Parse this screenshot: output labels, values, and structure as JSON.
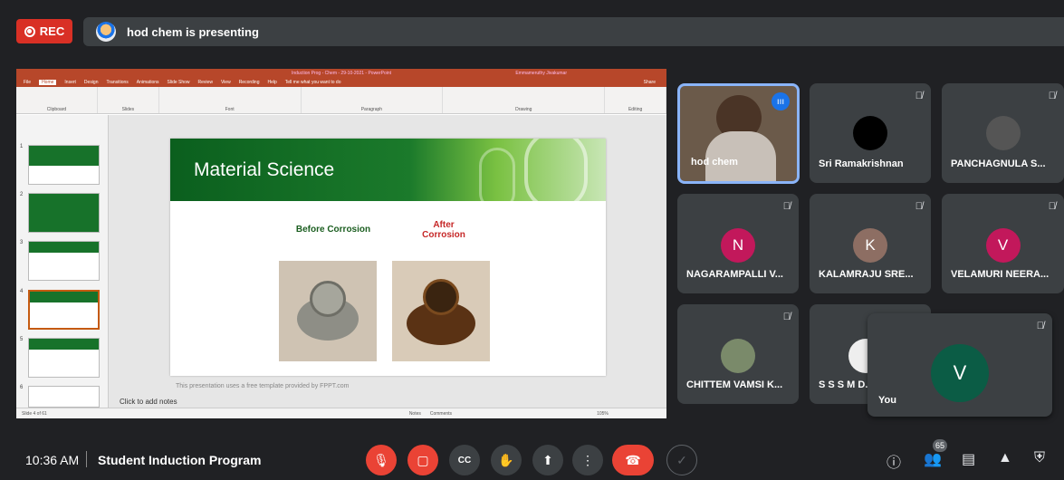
{
  "recording": {
    "label": "REC"
  },
  "presenter_bar": {
    "text": "hod chem is presenting"
  },
  "ppt": {
    "window_title": "Induction Prog - Chem - 29-10-2021 - PowerPoint",
    "user": "Emmameruthy Jivakumar",
    "share_label": "Share",
    "tabs": [
      "File",
      "Home",
      "Insert",
      "Design",
      "Transitions",
      "Animations",
      "Slide Show",
      "Review",
      "View",
      "Recording",
      "Help",
      "Tell me what you want to do"
    ],
    "ribbon_groups": [
      "Clipboard",
      "Slides",
      "Font",
      "Paragraph",
      "Drawing",
      "Editing"
    ],
    "slide_title": "Material Science",
    "caption_before": "Before Corrosion",
    "caption_after": "After Corrosion",
    "footer_note": "This presentation uses a free template provided by FPPT.com",
    "notes_placeholder": "Click to add notes",
    "status_left": "Slide 4 of 61",
    "status_notes": "Notes",
    "status_comments": "Comments",
    "status_zoom": "105%",
    "thumb_numbers": [
      "1",
      "2",
      "3",
      "4",
      "5",
      "6"
    ]
  },
  "participants": [
    {
      "name": "hod chem",
      "initial": "",
      "color": ""
    },
    {
      "name": "Sri Ramakrishnan",
      "initial": "",
      "color": "#000000"
    },
    {
      "name": "PANCHAGNULA S...",
      "initial": "",
      "color": "#555555"
    },
    {
      "name": "NAGARAMPALLI V...",
      "initial": "N",
      "color": "#c2185b"
    },
    {
      "name": "KALAMRAJU SRE...",
      "initial": "K",
      "color": "#8d6e63"
    },
    {
      "name": "VELAMURI NEERA...",
      "initial": "V",
      "color": "#c2185b"
    },
    {
      "name": "CHITTEM VAMSI K...",
      "initial": "",
      "color": "#7a8a6a"
    },
    {
      "name": "S S S M D...",
      "initial": "",
      "color": "#eeeeee"
    }
  ],
  "self_tile": {
    "name": "You",
    "initial": "V",
    "color": "#0b5c45"
  },
  "bottom_bar": {
    "time": "10:36 AM",
    "meeting_name": "Student Induction Program",
    "people_count": "65"
  }
}
